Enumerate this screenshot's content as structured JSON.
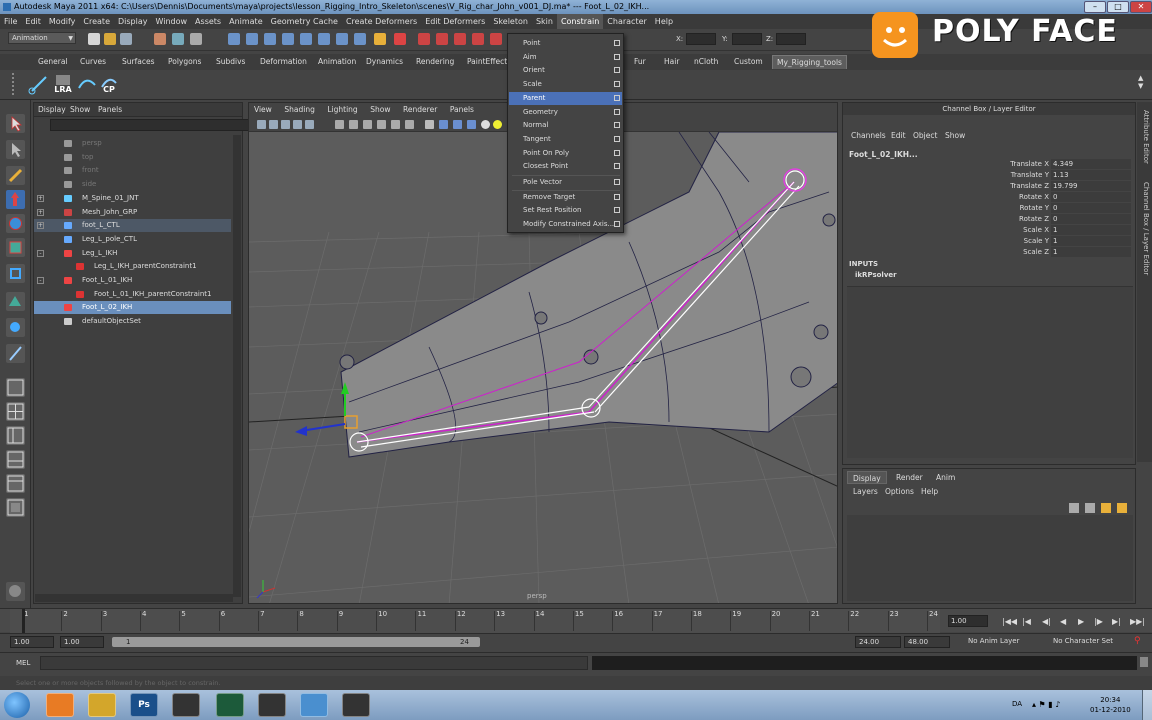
{
  "window": {
    "title": "Autodesk Maya 2011 x64: C:\\Users\\Dennis\\Documents\\maya\\projects\\lesson_Rigging_Intro_Skeleton\\scenes\\V_Rig_char_John_v001_DJ.ma* --- Foot_L_02_IKH..."
  },
  "menubar": [
    "File",
    "Edit",
    "Modify",
    "Create",
    "Display",
    "Window",
    "Assets",
    "Animate",
    "Geometry Cache",
    "Create Deformers",
    "Edit Deformers",
    "Skeleton",
    "Skin",
    "Constrain",
    "Character",
    "Help"
  ],
  "statusline": {
    "mode": "Animation",
    "x_label": "X:",
    "y_label": "Y:",
    "z_label": "Z:"
  },
  "shelf_tabs": [
    "General",
    "Curves",
    "Surfaces",
    "Polygons",
    "Subdivs",
    "Deformation",
    "Animation",
    "Dynamics",
    "Rendering",
    "PaintEffects",
    "Fur",
    "Hair",
    "nCloth",
    "Custom",
    "My_Rigging_tools"
  ],
  "shelf_icons": [
    "",
    "LRA",
    "",
    "CP"
  ],
  "outliner": {
    "menu": [
      "Display",
      "Show",
      "Panels"
    ],
    "items": [
      {
        "label": "persp",
        "type": "camera",
        "dim": true,
        "expand": ""
      },
      {
        "label": "top",
        "type": "camera",
        "dim": true,
        "expand": ""
      },
      {
        "label": "front",
        "type": "camera",
        "dim": true,
        "expand": ""
      },
      {
        "label": "side",
        "type": "camera",
        "dim": true,
        "expand": ""
      },
      {
        "label": "M_Spine_01_JNT",
        "type": "joint",
        "dim": false,
        "expand": "+"
      },
      {
        "label": "Mesh_John_GRP",
        "type": "mesh",
        "dim": false,
        "expand": "+"
      },
      {
        "label": "foot_L_CTL",
        "type": "curve",
        "dim": false,
        "expand": "+",
        "hl": true
      },
      {
        "label": "Leg_L_pole_CTL",
        "type": "curve",
        "dim": false,
        "expand": ""
      },
      {
        "label": "Leg_L_IKH",
        "type": "ikh",
        "dim": false,
        "expand": "-"
      },
      {
        "label": "Leg_L_IKH_parentConstraint1",
        "type": "constraint",
        "dim": false,
        "expand": "",
        "indent": 1
      },
      {
        "label": "Foot_L_01_IKH",
        "type": "ikh",
        "dim": false,
        "expand": "-"
      },
      {
        "label": "Foot_L_01_IKH_parentConstraint1",
        "type": "constraint",
        "dim": false,
        "expand": "",
        "indent": 1
      },
      {
        "label": "Foot_L_02_IKH",
        "type": "ikh",
        "dim": false,
        "expand": "",
        "sel": true
      },
      {
        "label": "defaultObjectSet",
        "type": "set",
        "dim": false,
        "expand": ""
      }
    ]
  },
  "viewport": {
    "menu": [
      "View",
      "Shading",
      "Lighting",
      "Show",
      "Renderer",
      "Panels"
    ],
    "camera_label": "persp"
  },
  "constrain_menu": {
    "items": [
      {
        "label": "Point",
        "sep_after": false
      },
      {
        "label": "Aim",
        "sep_after": false
      },
      {
        "label": "Orient",
        "sep_after": false
      },
      {
        "label": "Scale",
        "sep_after": false
      },
      {
        "label": "Parent",
        "sep_after": false,
        "highlighted": true
      },
      {
        "label": "Geometry",
        "sep_after": false
      },
      {
        "label": "Normal",
        "sep_after": false
      },
      {
        "label": "Tangent",
        "sep_after": false
      },
      {
        "label": "Point On Poly",
        "sep_after": false
      },
      {
        "label": "Closest Point",
        "sep_after": true
      },
      {
        "label": "Pole Vector",
        "sep_after": true
      },
      {
        "label": "Remove Target",
        "sep_after": false
      },
      {
        "label": "Set Rest Position",
        "sep_after": false
      },
      {
        "label": "Modify Constrained Axis...",
        "sep_after": false
      }
    ]
  },
  "logo": {
    "text": "POLY FACE",
    "color": "#f5941f"
  },
  "channel_box": {
    "title": "Channel Box / Layer Editor",
    "menu": [
      "Channels",
      "Edit",
      "Object",
      "Show"
    ],
    "object": "Foot_L_02_IKH...",
    "channels": [
      {
        "label": "Translate X",
        "value": "4.349"
      },
      {
        "label": "Translate Y",
        "value": "1.13"
      },
      {
        "label": "Translate Z",
        "value": "19.799"
      },
      {
        "label": "Rotate X",
        "value": "0"
      },
      {
        "label": "Rotate Y",
        "value": "0"
      },
      {
        "label": "Rotate Z",
        "value": "0"
      },
      {
        "label": "Scale X",
        "value": "1"
      },
      {
        "label": "Scale Y",
        "value": "1"
      },
      {
        "label": "Scale Z",
        "value": "1"
      }
    ],
    "inputs_label": "INPUTS",
    "solver": "ikRPsolver"
  },
  "side_tabs": [
    "Attribute Editor",
    "Channel Box / Layer Editor"
  ],
  "layer_editor": {
    "tabs": [
      "Display",
      "Render",
      "Anim"
    ],
    "menu": [
      "Layers",
      "Options",
      "Help"
    ]
  },
  "timeline": {
    "ticks": [
      "1",
      "2",
      "3",
      "4",
      "5",
      "6",
      "7",
      "8",
      "9",
      "10",
      "11",
      "12",
      "13",
      "14",
      "15",
      "16",
      "17",
      "18",
      "19",
      "20",
      "21",
      "22",
      "23",
      "24"
    ],
    "current": "1.00"
  },
  "range": {
    "start": "1.00",
    "start2": "1.00",
    "inner_start": "1",
    "inner_end": "24",
    "end": "24.00",
    "end2": "48.00",
    "anim_layer": "No Anim Layer",
    "char_set": "No Character Set"
  },
  "mel": {
    "label": "MEL"
  },
  "helpline": "Select one or more objects followed by the object to constrain.",
  "taskbar": {
    "lang": "DA",
    "time": "20:34",
    "date": "01-12-2010",
    "apps": [
      "",
      "",
      "Ps",
      "",
      "",
      "",
      "",
      ""
    ]
  }
}
